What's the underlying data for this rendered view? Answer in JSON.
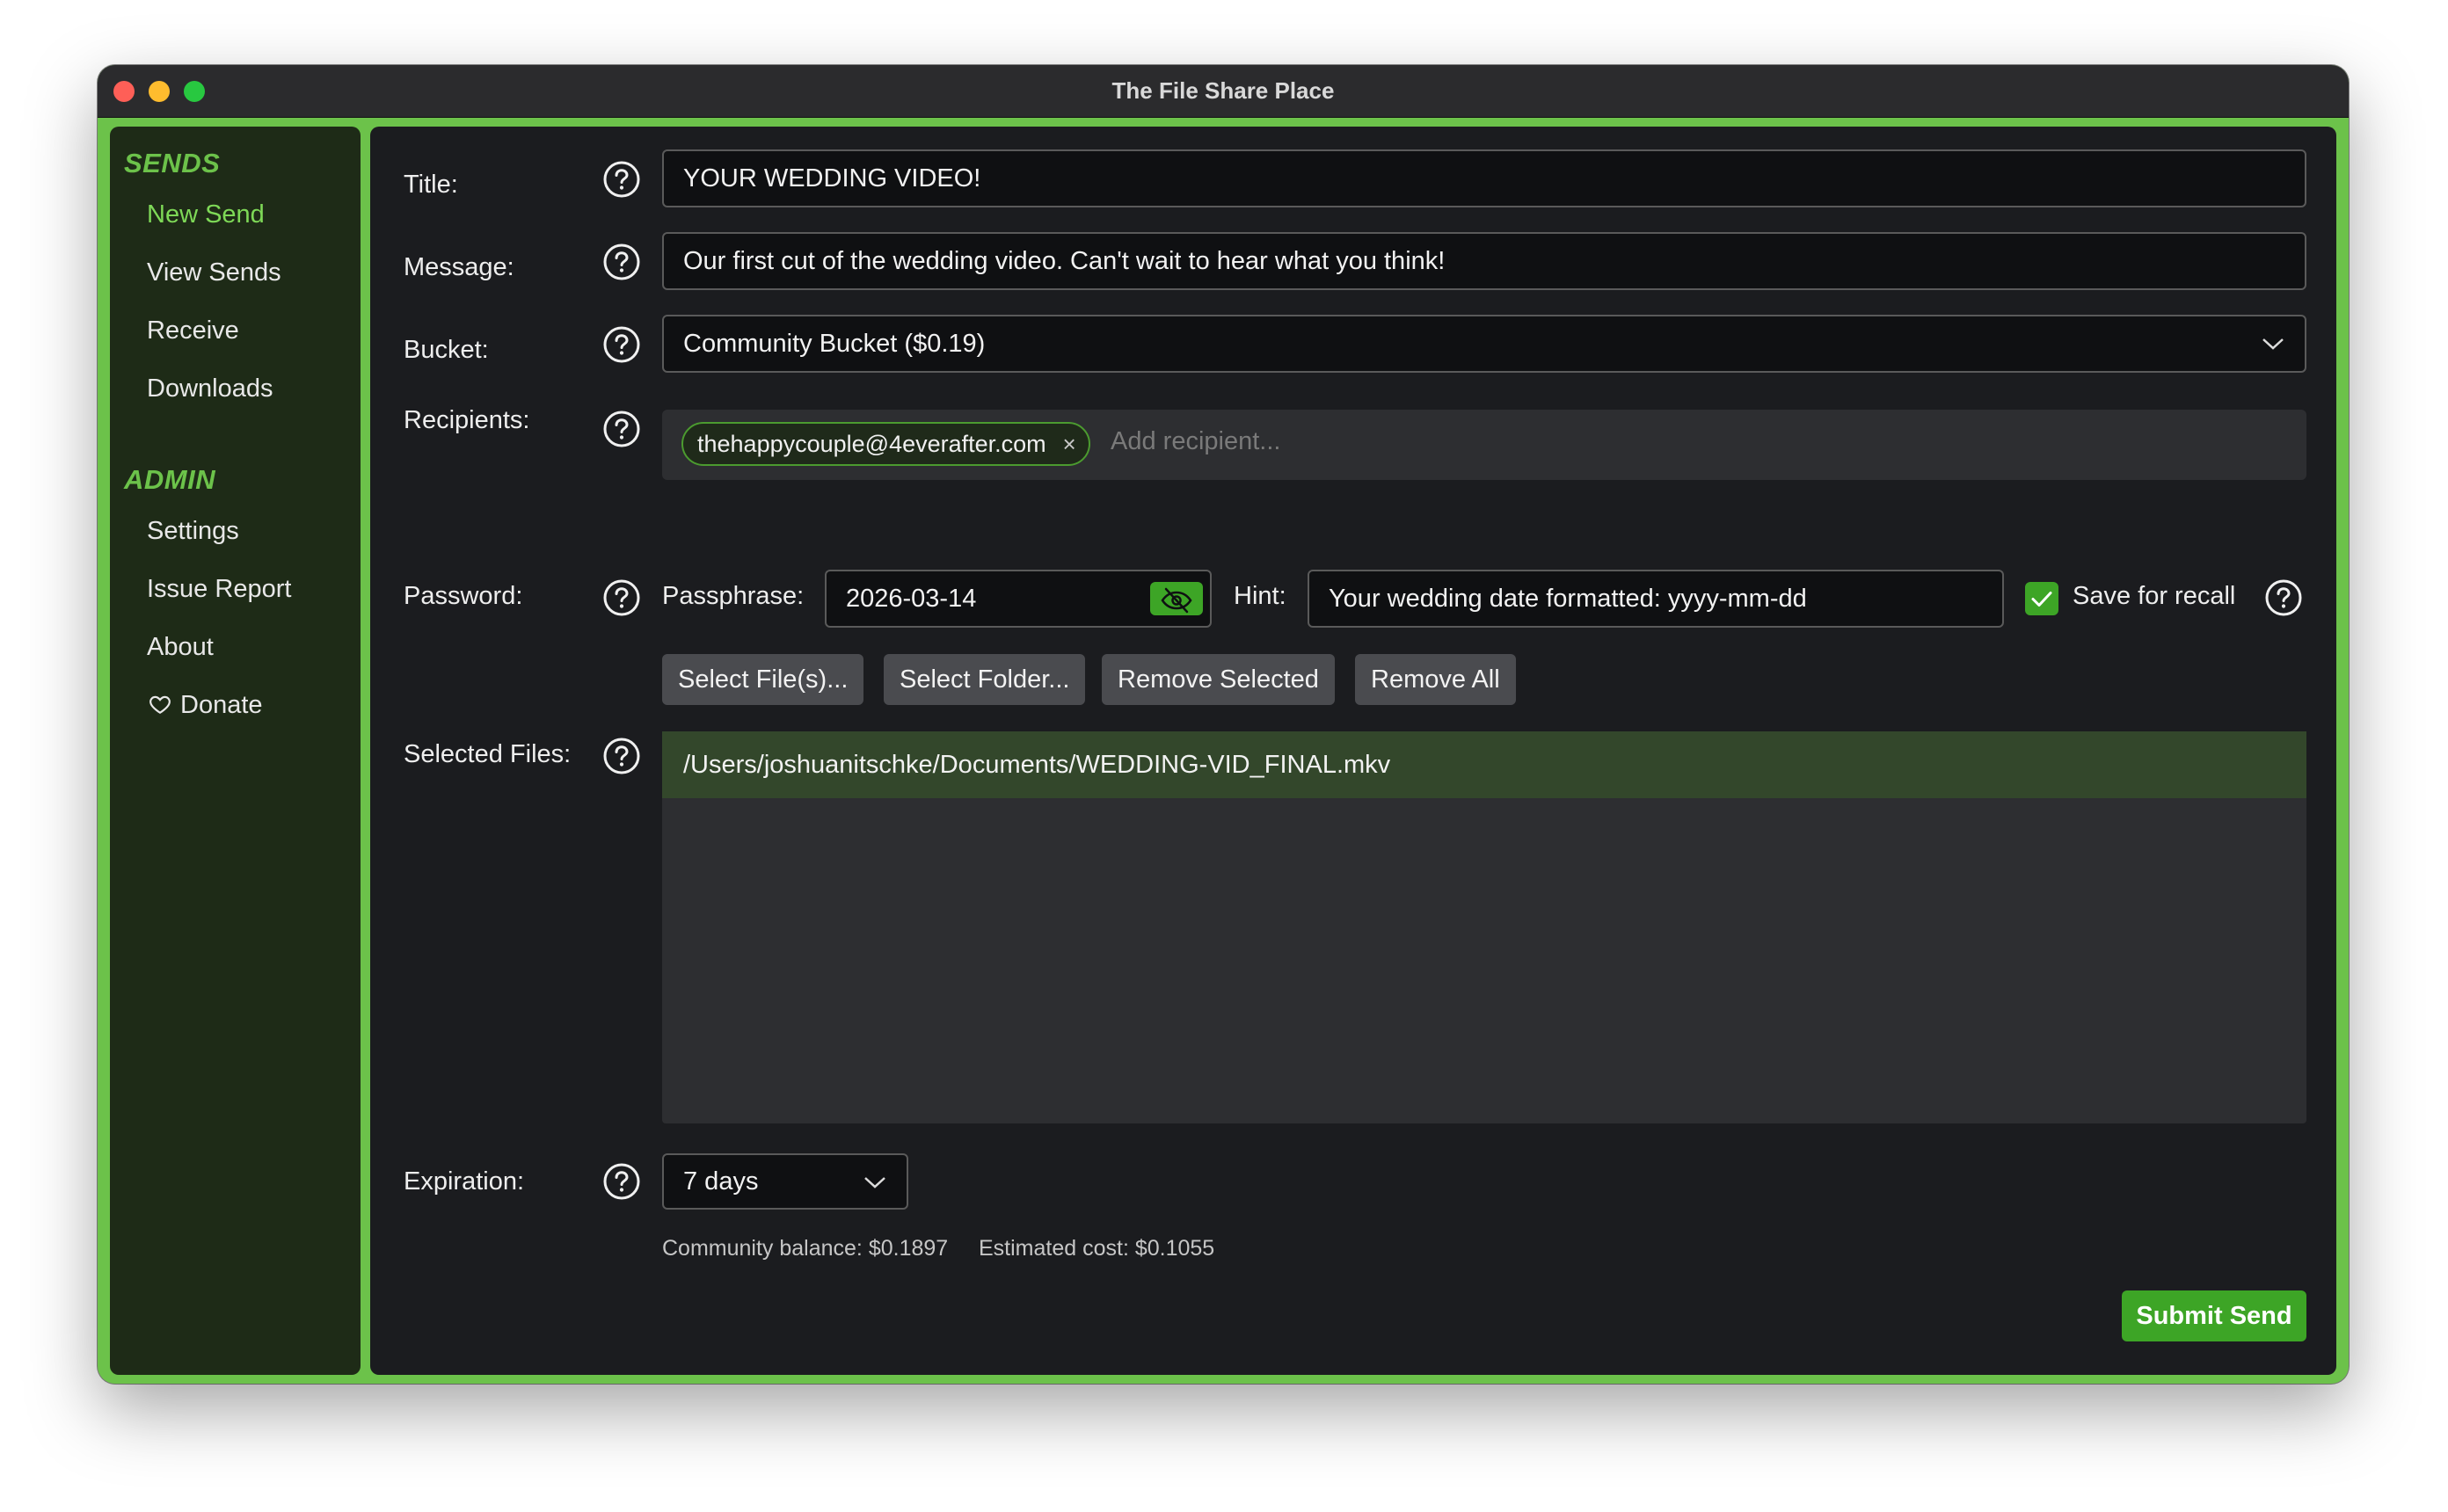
{
  "window": {
    "title": "The File Share Place"
  },
  "sidebar": {
    "sends_heading": "SENDS",
    "sends_items": [
      {
        "label": "New Send",
        "active": true
      },
      {
        "label": "View Sends"
      },
      {
        "label": "Receive"
      },
      {
        "label": "Downloads"
      }
    ],
    "admin_heading": "ADMIN",
    "admin_items": [
      {
        "label": "Settings"
      },
      {
        "label": "Issue Report"
      },
      {
        "label": "About"
      },
      {
        "label": "Donate",
        "icon": "heart-icon"
      }
    ]
  },
  "form": {
    "title_label": "Title:",
    "title_value": "YOUR WEDDING VIDEO!",
    "message_label": "Message:",
    "message_value": "Our first cut of the wedding video. Can't wait to hear what you think!",
    "bucket_label": "Bucket:",
    "bucket_value": "Community Bucket ($0.19)",
    "recipients_label": "Recipients:",
    "recipient_chip": "thehappycouple@4everafter.com",
    "recipient_chip_remove": "×",
    "recipient_placeholder": "Add recipient...",
    "password_label": "Password:",
    "passphrase_label": "Passphrase:",
    "passphrase_value": "2026-03-14",
    "hint_label": "Hint:",
    "hint_value": "Your wedding date formatted: yyyy-mm-dd",
    "save_recall_label": "Save for recall",
    "save_recall_checked": true,
    "buttons": {
      "select_files": "Select File(s)...",
      "select_folder": "Select Folder...",
      "remove_selected": "Remove Selected",
      "remove_all": "Remove All"
    },
    "selected_files_label": "Selected Files:",
    "selected_files": [
      "/Users/joshuanitschke/Documents/WEDDING-VID_FINAL.mkv"
    ],
    "expiration_label": "Expiration:",
    "expiration_value": "7 days",
    "community_balance": "Community balance: $0.1897",
    "estimated_cost": "Estimated cost: $0.1055",
    "submit_label": "Submit Send"
  },
  "colors": {
    "accent": "#6cc24a",
    "button_green": "#3da526",
    "sidebar_bg": "#1e2b17",
    "main_bg": "#1b1c1f"
  }
}
